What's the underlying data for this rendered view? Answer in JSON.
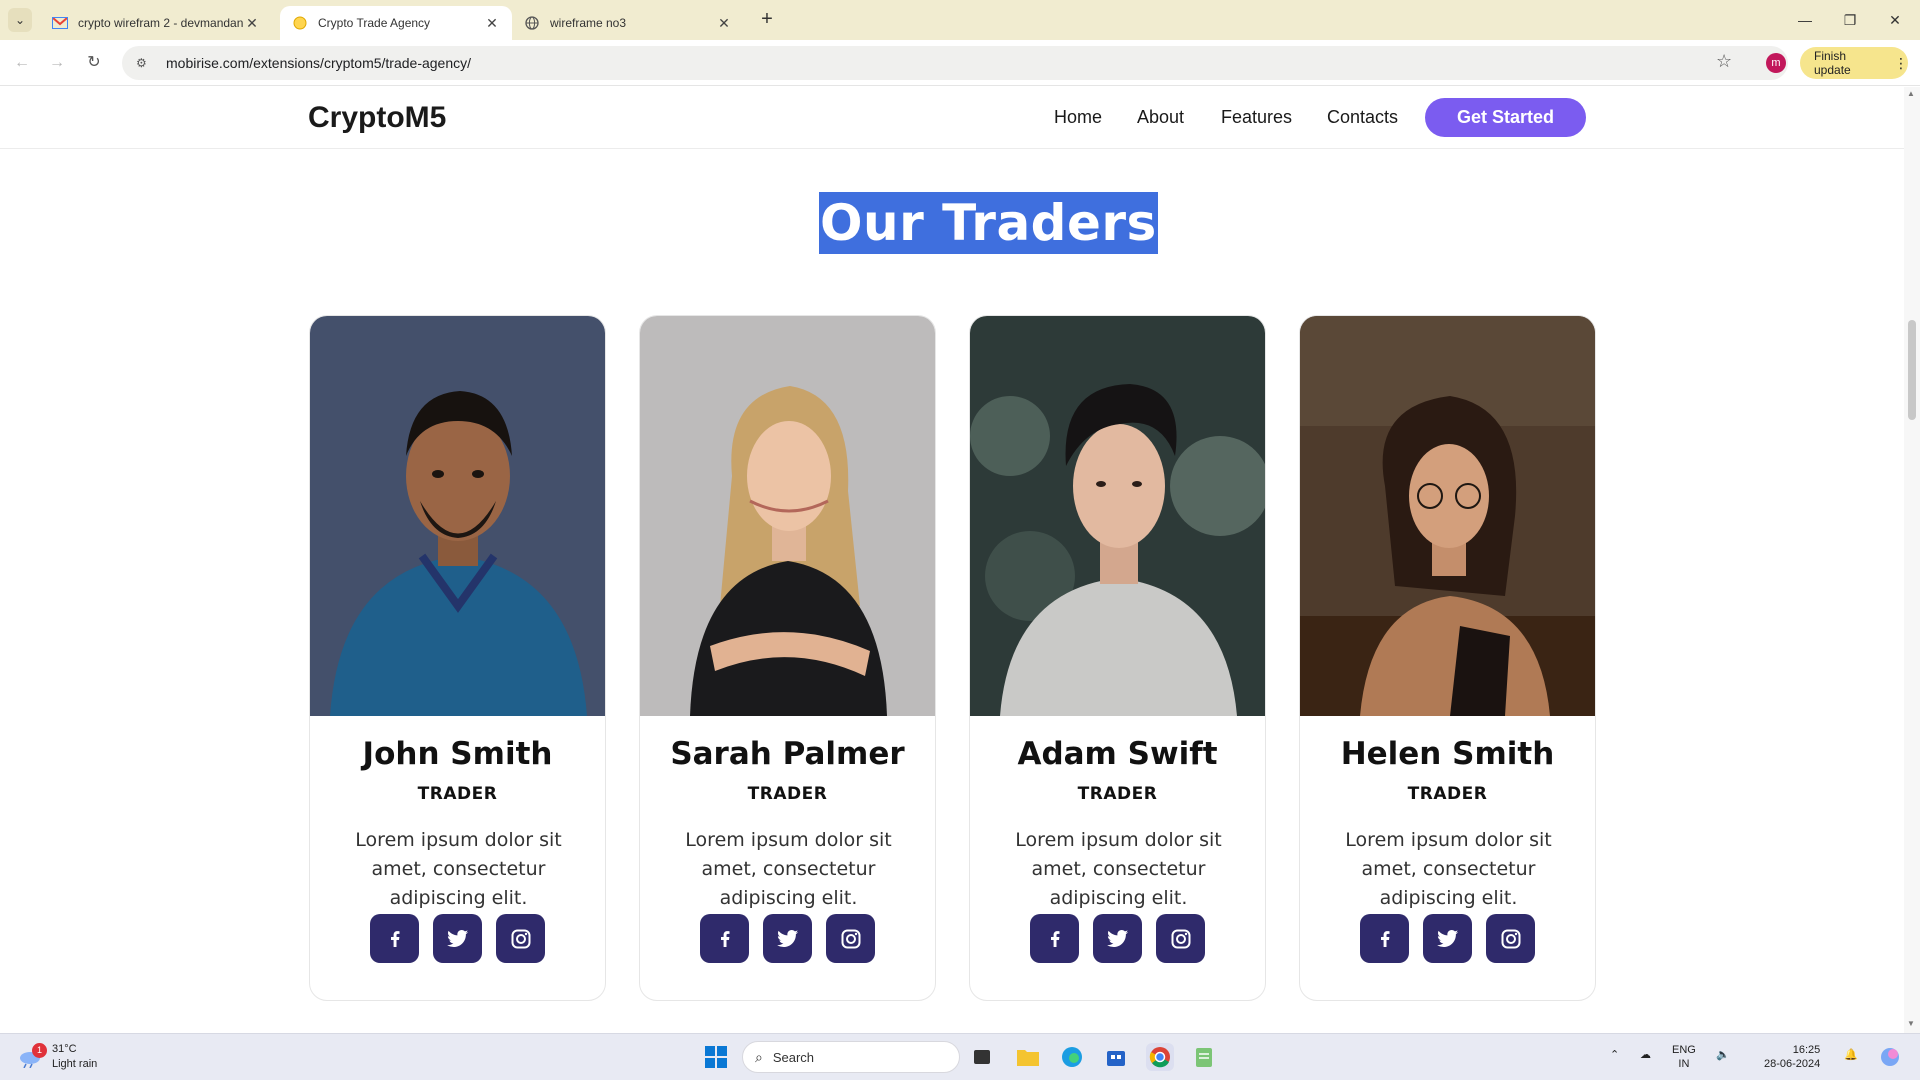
{
  "browser": {
    "tabs": [
      {
        "title": "crypto wirefram 2 - devmandan",
        "icon": "gmail-icon",
        "active": false
      },
      {
        "title": "Crypto Trade Agency",
        "icon": "mobirise-icon",
        "active": true
      },
      {
        "title": "wireframe no3",
        "icon": "globe-icon",
        "active": false
      }
    ],
    "url": "mobirise.com/extensions/cryptom5/trade-agency/",
    "profile_initial": "m",
    "finish_update_label": "Finish update"
  },
  "site": {
    "brand": "CryptoM5",
    "nav": {
      "home": "Home",
      "about": "About",
      "features": "Features",
      "contacts": "Contacts",
      "cta": "Get Started"
    },
    "accent": "#7b5cf0",
    "section_title": "Our Traders",
    "traders": [
      {
        "name": "John Smith",
        "role": "TRADER",
        "bio": "Lorem ipsum dolor sit amet, consectetur adipiscing elit."
      },
      {
        "name": "Sarah Palmer",
        "role": "TRADER",
        "bio": "Lorem ipsum dolor sit amet, consectetur adipiscing elit."
      },
      {
        "name": "Adam Swift",
        "role": "TRADER",
        "bio": "Lorem ipsum dolor sit amet, consectetur adipiscing elit."
      },
      {
        "name": "Helen Smith",
        "role": "TRADER",
        "bio": "Lorem ipsum dolor sit amet, consectetur adipiscing elit."
      }
    ],
    "social_icons": [
      "facebook-icon",
      "twitter-icon",
      "instagram-icon"
    ]
  },
  "taskbar": {
    "weather_temp": "31°C",
    "weather_desc": "Light rain",
    "weather_badge": "1",
    "search_label": "Search",
    "lang_top": "ENG",
    "lang_bottom": "IN",
    "time": "16:25",
    "date": "28-06-2024"
  }
}
